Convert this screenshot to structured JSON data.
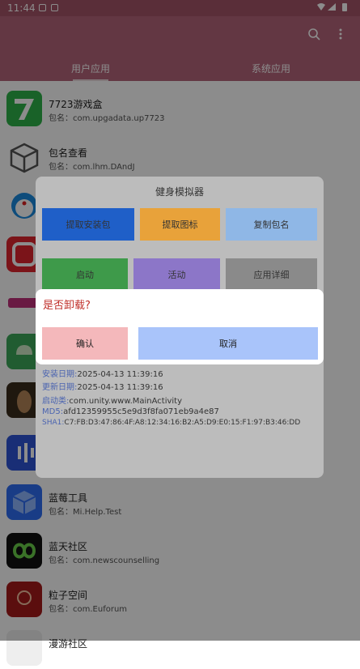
{
  "status": {
    "time": "11:44"
  },
  "tabs": [
    {
      "label": "用户应用"
    },
    {
      "label": "系统应用"
    }
  ],
  "apps": [
    {
      "name": "7723游戏盒",
      "pkg": "包名：com.upgadata.up7723"
    },
    {
      "name": "包名查看",
      "pkg": "包名：com.lhm.DAndJ"
    },
    {
      "name": "蓝莓工具",
      "pkg": "包名：Mi.Help.Test"
    },
    {
      "name": "蓝天社区",
      "pkg": "包名：com.newscounselling"
    },
    {
      "name": "粒子空间",
      "pkg": "包名：com.Euforum"
    },
    {
      "name": "漫游社区",
      "pkg": ""
    }
  ],
  "sheet": {
    "title": "健身模拟器",
    "buttons": [
      {
        "label": "提取安装包",
        "color": "#1f5fc8"
      },
      {
        "label": "提取图标",
        "color": "#e8a23a"
      },
      {
        "label": "复制包名",
        "color": "#8fb7e6"
      },
      {
        "label": "启动",
        "color": "#3e9a4a"
      },
      {
        "label": "活动",
        "color": "#8c76c8"
      },
      {
        "label": "应用详细",
        "color": "#8a8a8a"
      }
    ],
    "info": [
      {
        "key": "安装日期:",
        "val": "2025-04-13 11:39:16"
      },
      {
        "key": "更新日期:",
        "val": "2025-04-13 11:39:16"
      },
      {
        "key": "启动类:",
        "val": "com.unity.www.MainActivity"
      },
      {
        "key": "MD5:",
        "val": "afd12359955c5e9d3f8fa071eb9a4e87"
      },
      {
        "key": "SHA1:",
        "val": "C7:FB:D3:47:86:4F:A8:12:34:16:B2:A5:D9:E0:15:F1:97:B3:46:DD"
      }
    ]
  },
  "dialog": {
    "question": "是否卸载?",
    "ok": "确认",
    "cancel": "取消"
  }
}
